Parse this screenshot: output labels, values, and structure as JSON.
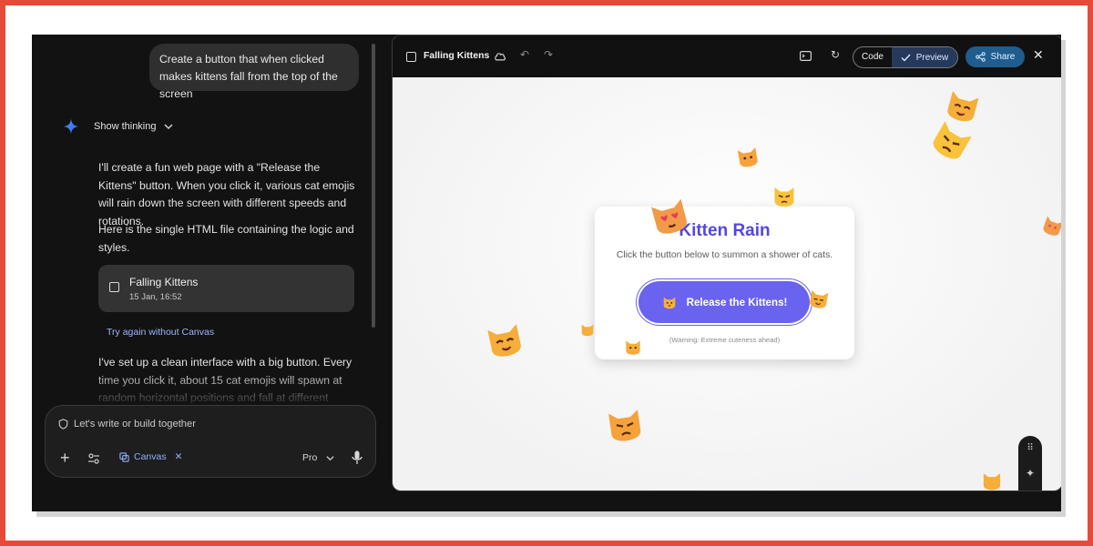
{
  "chat": {
    "user_message": "Create a button that when clicked makes kittens fall from the top of the screen",
    "show_thinking_label": "Show thinking",
    "response_p1": "I'll create a fun web page with a \"Release the Kittens\" button. When you click it, various cat emojis will rain down the screen with different speeds and rotations.",
    "response_p2": "Here is the single HTML file containing the logic and styles.",
    "canvas_card": {
      "title": "Falling Kittens",
      "date": "15 Jan, 16:52"
    },
    "try_again_label": "Try again without Canvas",
    "response_p3": "I've set up a clean interface with a big button. Every time you click it, about 15 cat emojis will spawn at random horizontal positions and fall at different speeds.",
    "composer": {
      "placeholder": "Let's write or build together",
      "canvas_chip": "Canvas",
      "model_label": "Pro"
    }
  },
  "preview": {
    "title": "Falling Kittens",
    "tab_code": "Code",
    "tab_preview": "Preview",
    "share_label": "Share",
    "page": {
      "title": "Kitten Rain",
      "subtitle": "Click the button below to summon a shower of cats.",
      "button_label": "Release the Kittens!",
      "warning": "(Warning: Extreme cuteness ahead)"
    }
  },
  "colors": {
    "accent_purple": "#6a63ef",
    "title_purple": "#5546e0",
    "link_blue": "#9bb5ff",
    "share_blue": "#1f5d8e",
    "outer_border": "#e84a3a"
  },
  "icons": [
    "sparkle-icon",
    "chevron-down-icon",
    "code-window-icon",
    "plus-icon",
    "tune-icon",
    "canvas-icon",
    "close-icon",
    "mic-icon",
    "cloud-icon",
    "undo-icon",
    "redo-icon",
    "terminal-icon",
    "refresh-icon",
    "check-icon",
    "share-icon",
    "cat-emoji-icon"
  ]
}
